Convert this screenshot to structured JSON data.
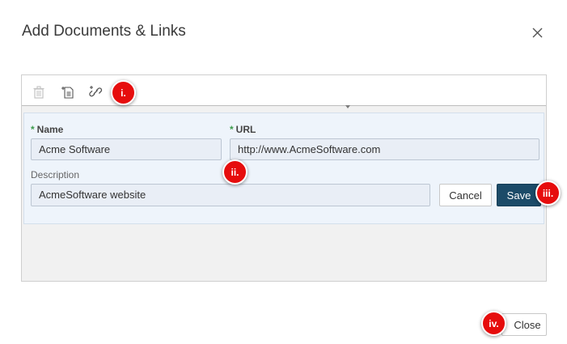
{
  "dialog": {
    "title": "Add Documents & Links"
  },
  "toolbar": {
    "icons": [
      "trash-icon",
      "add-document-icon",
      "add-link-icon"
    ]
  },
  "form": {
    "name_label": "Name",
    "name_value": "Acme Software",
    "url_label": "URL",
    "url_value": "http://www.AcmeSoftware.com",
    "description_label": "Description",
    "description_value": "AcmeSoftware website",
    "required_mark": "*",
    "cancel_label": "Cancel",
    "save_label": "Save"
  },
  "footer": {
    "close_label": "Close"
  },
  "markers": [
    "i.",
    "ii.",
    "iii.",
    "iv."
  ],
  "colors": {
    "primary_button": "#1c4b68",
    "required": "#3c9b4b",
    "marker": "#e60d0d",
    "form_bg": "#eef4fb"
  }
}
